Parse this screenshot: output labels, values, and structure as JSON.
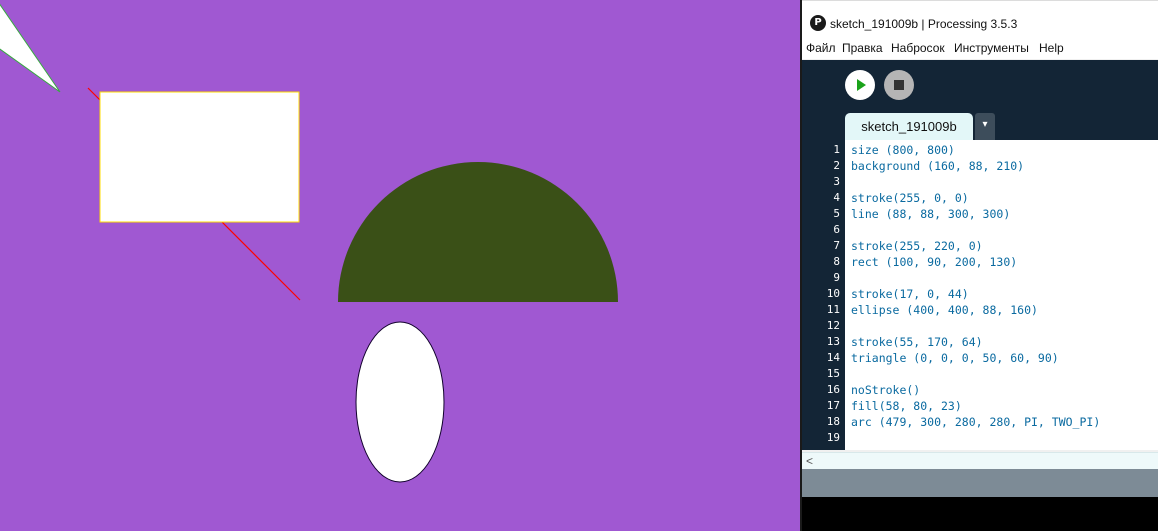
{
  "window": {
    "title": "sketch_191009b | Processing 3.5.3",
    "app_icon_glyph": "P"
  },
  "menu": {
    "items": [
      "Файл",
      "Правка",
      "Набросок",
      "Инструменты",
      "Help"
    ]
  },
  "toolbar": {
    "run_icon": "play-icon",
    "stop_icon": "stop-icon"
  },
  "tabs": {
    "active_label": "sketch_191009b",
    "menu_glyph": "▾"
  },
  "editor": {
    "lines": [
      "size (800, 800)",
      "background (160, 88, 210)",
      "",
      "stroke(255, 0, 0)",
      "line (88, 88, 300, 300)",
      "",
      "stroke(255, 220, 0)",
      "rect (100, 90, 200, 130)",
      "",
      "stroke(17, 0, 44)",
      "ellipse (400, 400, 88, 160)",
      "",
      "stroke(55, 170, 64)",
      "triangle (0, 0, 0, 50, 60, 90)",
      "",
      "noStroke()",
      "fill(58, 80, 23)",
      "arc (479, 300, 280, 280, PI, TWO_PI)",
      ""
    ],
    "line_numbers": [
      "1",
      "2",
      "3",
      "4",
      "5",
      "6",
      "7",
      "8",
      "9",
      "10",
      "11",
      "12",
      "13",
      "14",
      "15",
      "16",
      "17",
      "18",
      "19"
    ]
  },
  "scrollbar": {
    "left_arrow": "<"
  },
  "colors": {
    "sketch_background": "#a058d2",
    "line_stroke": "#ff0000",
    "rect_stroke": "#ffdc00",
    "ellipse_stroke": "#11002c",
    "triangle_stroke": "#37aa40",
    "arc_fill": "#3a5017",
    "ide_toolbar": "#132536",
    "keyword": "#0a6aa0"
  }
}
